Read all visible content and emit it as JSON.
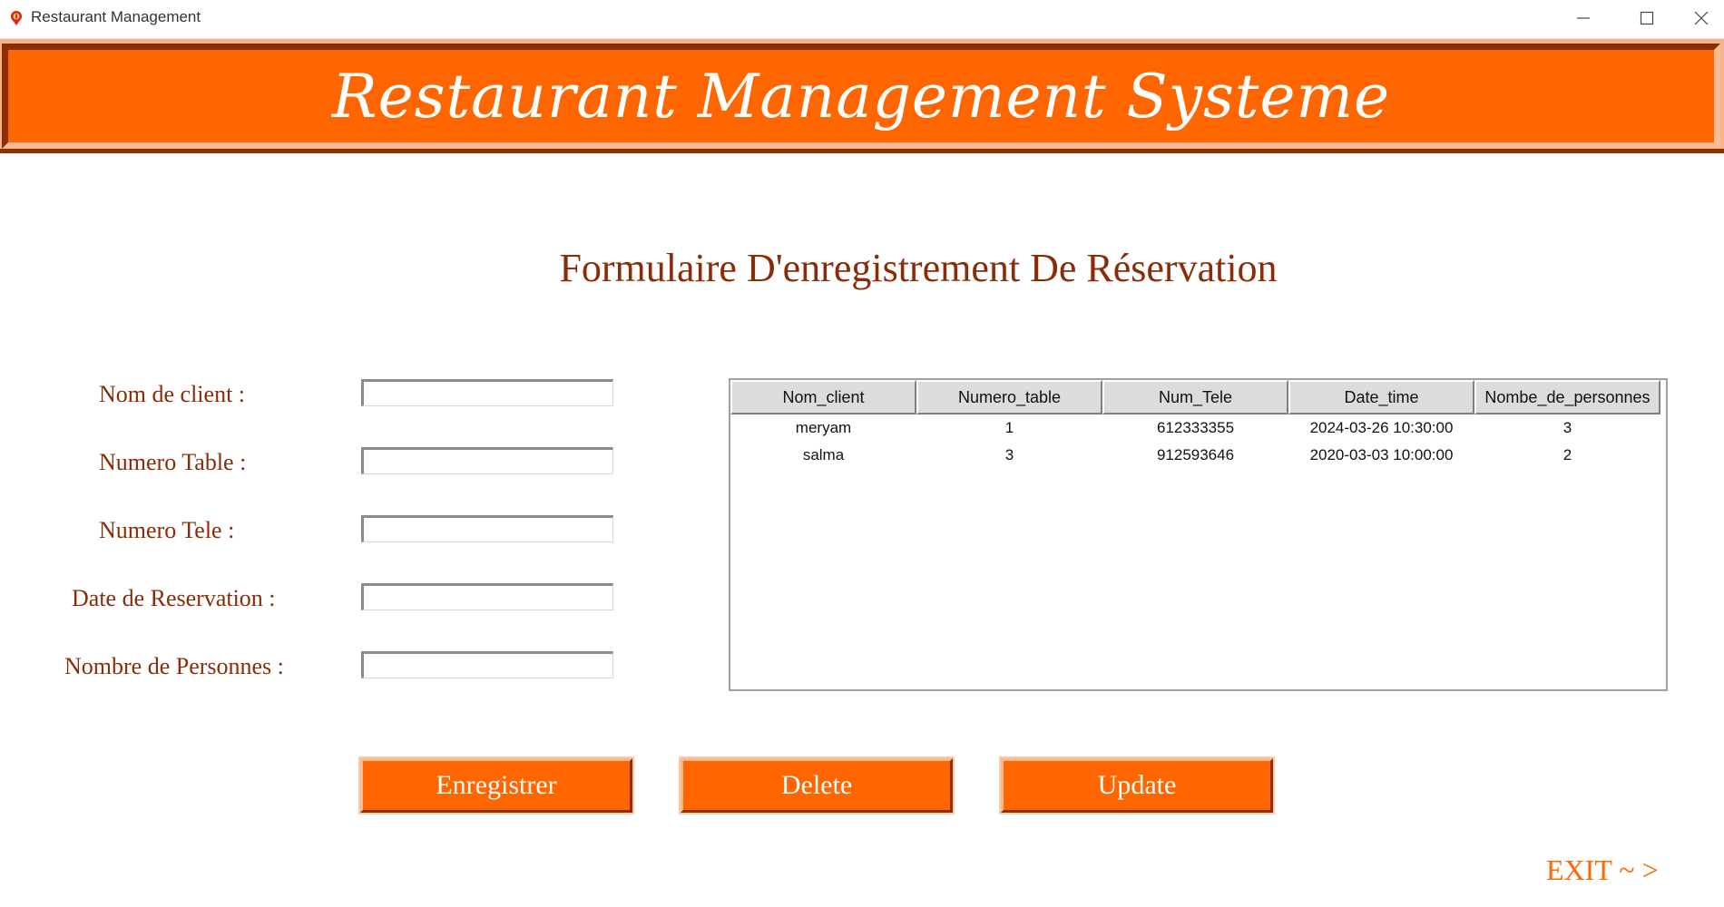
{
  "window": {
    "title": "Restaurant Management",
    "icon": "restaurant-app-icon"
  },
  "header": {
    "title": "Restaurant Management Systeme"
  },
  "form": {
    "title": "Formulaire D'enregistrement De Réservation",
    "fields": [
      {
        "label": "Nom de client :",
        "value": ""
      },
      {
        "label": "Numero Table :",
        "value": ""
      },
      {
        "label": "Numero Tele :",
        "value": ""
      },
      {
        "label": "Date de Reservation :",
        "value": ""
      },
      {
        "label": "Nombre de Personnes :",
        "value": ""
      }
    ]
  },
  "table": {
    "columns": [
      "Nom_client",
      "Numero_table",
      "Num_Tele",
      "Date_time",
      "Nombe_de_personnes"
    ],
    "rows": [
      [
        "meryam",
        "1",
        "612333355",
        "2024-03-26 10:30:00",
        "3"
      ],
      [
        "salma",
        "3",
        "912593646",
        "2020-03-03 10:00:00",
        "2"
      ]
    ]
  },
  "actions": {
    "save_label": "Enregistrer",
    "delete_label": "Delete",
    "update_label": "Update",
    "exit_label": "EXIT ~ >"
  },
  "colors": {
    "accent": "#ff6600",
    "label_text": "#8b2c08",
    "banner_border_dark": "#8a3000"
  }
}
